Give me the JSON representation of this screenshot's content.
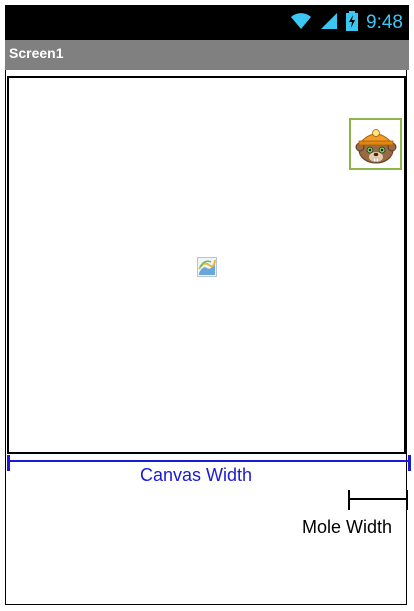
{
  "status_bar": {
    "time": "9:48",
    "icons": [
      "wifi-icon",
      "signal-icon",
      "battery-charging-icon"
    ],
    "accent_color": "#3cc7f2"
  },
  "title_bar": {
    "title": "Screen1",
    "background": "#808080"
  },
  "canvas": {
    "mole_icon": "mole-sprite",
    "background_icon": "broken-image-icon"
  },
  "annotations": {
    "canvas_width_label": "Canvas Width",
    "canvas_width_color": "#1a1ad6",
    "mole_width_label": "Mole Width"
  }
}
